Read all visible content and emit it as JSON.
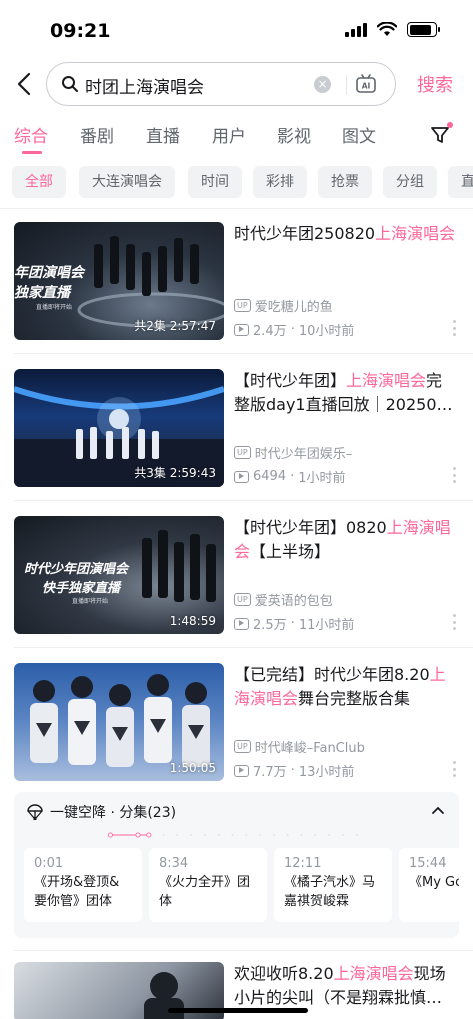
{
  "status_bar": {
    "time": "09:21",
    "battery_level": 0.85
  },
  "search": {
    "query": "时团上海演唱会",
    "submit_label": "搜索",
    "ai_label": "AI"
  },
  "tabs": [
    "综合",
    "番剧",
    "直播",
    "用户",
    "影视",
    "图文"
  ],
  "active_tab": "综合",
  "chips": [
    "全部",
    "大连演唱会",
    "时间",
    "彩排",
    "抢票",
    "分组",
    "直"
  ],
  "videos": [
    {
      "title_pre": "时代少年团250820",
      "title_hl": "上海演唱会",
      "title_post": "",
      "thumb_caption_1": "年团演唱会",
      "thumb_caption_2": "独家直播",
      "thumb_caption_3": "直播即将开始",
      "duration": "共2集 2:57:47",
      "author": "爱吃糖儿的鱼",
      "views": "2.4万",
      "time": "10小时前"
    },
    {
      "title_pre": "【时代少年团】",
      "title_hl": "上海演唱会",
      "title_post": "完整版day1直播回放｜20250…",
      "duration": "共3集 2:59:43",
      "author": "时代少年团娱乐–",
      "views": "6494",
      "time": "1小时前"
    },
    {
      "title_pre": "【时代少年团】0820",
      "title_hl": "上海演唱会",
      "title_post": "【上半场】",
      "thumb_caption_1": "时代少年团演唱会",
      "thumb_caption_2": "快手独家直播",
      "thumb_caption_3": "直播即将开始",
      "duration": "1:48:59",
      "author": "爱英语的包包",
      "views": "2.5万",
      "time": "11小时前"
    },
    {
      "title_pre": "【已完结】时代少年团8.20",
      "title_hl": "上海演唱会",
      "title_post": "舞台完整版合集",
      "duration": "1:50:05",
      "author": "时代峰峻–FanClub",
      "views": "7.7万",
      "time": "13小时前"
    }
  ],
  "episodes": {
    "header": "一键空降 · 分集(23)",
    "items": [
      {
        "time": "0:01",
        "title": "《开场&登顶&要你管》团体"
      },
      {
        "time": "8:34",
        "title": "《火力全开》团体"
      },
      {
        "time": "12:11",
        "title": "《橘子汽水》马嘉祺贺峻霖"
      },
      {
        "time": "15:44",
        "title": "《My Gospel"
      }
    ]
  },
  "last_video": {
    "title_pre": "欢迎收听8.20",
    "title_hl": "上海演唱会",
    "title_post": "现场小片的尖叫（不是翔霖批慎…"
  },
  "colors": {
    "accent": "#ff6699",
    "text": "#18191c",
    "secondary": "#9499a0",
    "chip_bg": "#f1f2f3"
  }
}
